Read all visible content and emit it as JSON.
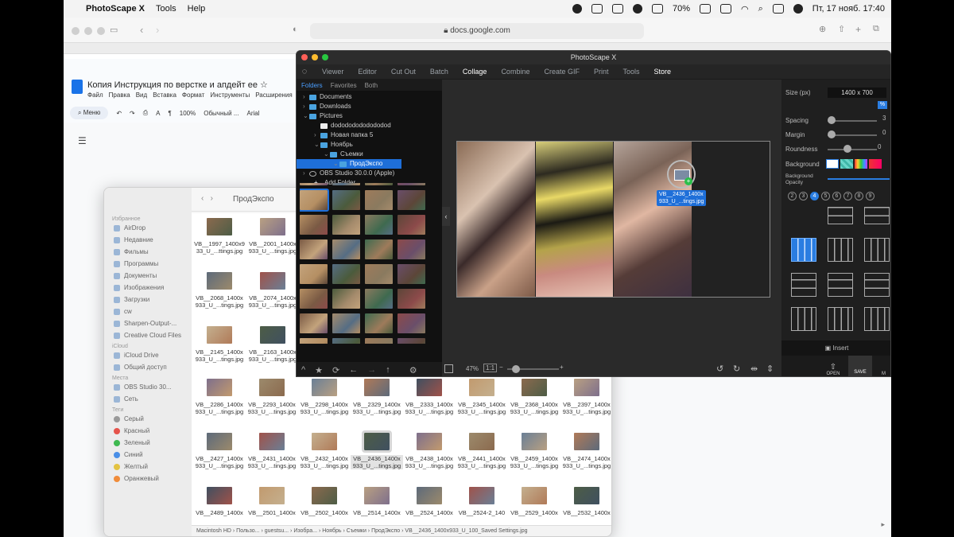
{
  "menubar": {
    "app_name": "PhotoScape X",
    "items": [
      "Tools",
      "Help"
    ],
    "battery": "70%",
    "date_time": "Пт, 17 нояб.  17:40"
  },
  "browser": {
    "url": "docs.google.com"
  },
  "doc": {
    "title": "Копия Инструкция по верстке и апдейт ее",
    "menu": [
      "Файл",
      "Правка",
      "Вид",
      "Вставка",
      "Формат",
      "Инструменты",
      "Расширения"
    ],
    "search_label": "Меню",
    "zoom": "100%",
    "style": "Обычный ...",
    "font": "Arial"
  },
  "finder": {
    "title": "ПродЭкспо",
    "sidebar": {
      "favorites_header": "Избранное",
      "favorites": [
        "AirDrop",
        "Недавние",
        "Фильмы",
        "Программы",
        "Документы",
        "Изображения",
        "Загрузки",
        "cw",
        "Sharpen-Output-...",
        "Creative Cloud Files"
      ],
      "icloud_header": "iCloud",
      "icloud": [
        "iCloud Drive",
        "Общий доступ"
      ],
      "places_header": "Места",
      "places": [
        "OBS Studio 30...",
        "Сеть"
      ],
      "tags_header": "Теги",
      "tags": [
        "Серый",
        "Красный",
        "Зеленый",
        "Синий",
        "Желтый",
        "Оранжевый"
      ]
    },
    "files": [
      {
        "l1": "VB__1997_1400x9",
        "l2": "33_U_...ttings.jpg"
      },
      {
        "l1": "VB__2001_1400x",
        "l2": "933_U_...tings.jpg"
      },
      {
        "l1": "VB__2068_1400x",
        "l2": "933_U_...tings.jpg"
      },
      {
        "l1": "VB__2074_1400x",
        "l2": "933_U_...tings.jpg"
      },
      {
        "l1": "VB__2145_1400x",
        "l2": "933_U_...tings.jpg"
      },
      {
        "l1": "VB__2163_1400x",
        "l2": "933_U_...tings.jpg"
      },
      {
        "l1": "VB__2286_1400x",
        "l2": "933_U_...tings.jpg"
      },
      {
        "l1": "VB__2293_1400x",
        "l2": "933_U_...tings.jpg"
      },
      {
        "l1": "VB__2298_1400x",
        "l2": "933_U_...tings.jpg"
      },
      {
        "l1": "VB__2329_1400x",
        "l2": "933_U_...tings.jpg"
      },
      {
        "l1": "VB__2333_1400x",
        "l2": "933_U_...tings.jpg"
      },
      {
        "l1": "VB__2345_1400x",
        "l2": "933_U_...tings.jpg"
      },
      {
        "l1": "VB__2368_1400x",
        "l2": "933_U_...tings.jpg"
      },
      {
        "l1": "VB__2397_1400x",
        "l2": "933_U_...tings.jpg"
      },
      {
        "l1": "VB__2427_1400x",
        "l2": "933_U_...tings.jpg"
      },
      {
        "l1": "VB__2431_1400x",
        "l2": "933_U_...tings.jpg"
      },
      {
        "l1": "VB__2432_1400x",
        "l2": "933_U_...tings.jpg"
      },
      {
        "l1": "VB__2436_1400x",
        "l2": "933_U_...tings.jpg"
      },
      {
        "l1": "VB__2438_1400x",
        "l2": "933_U_...tings.jpg"
      },
      {
        "l1": "VB__2441_1400x",
        "l2": "933_U_...tings.jpg"
      },
      {
        "l1": "VB__2459_1400x",
        "l2": "933_U_...tings.jpg"
      },
      {
        "l1": "VB__2474_1400x",
        "l2": "933_U_...tings.jpg"
      },
      {
        "l1": "VB__2489_1400x",
        "l2": ""
      },
      {
        "l1": "VB__2501_1400x",
        "l2": ""
      },
      {
        "l1": "VB__2502_1400x",
        "l2": ""
      },
      {
        "l1": "VB__2514_1400x",
        "l2": ""
      },
      {
        "l1": "VB__2524_1400x",
        "l2": ""
      },
      {
        "l1": "VB__2524-2_140",
        "l2": ""
      },
      {
        "l1": "VB__2529_1400x",
        "l2": ""
      },
      {
        "l1": "VB__2532_1400x",
        "l2": ""
      }
    ],
    "selected_index": 17,
    "path": "Macintosh HD  ›  Пользо...  ›  guestsu...  ›  Изобра...  ›  Ноябрь  ›  Съемки  ›  ПродЭкспо  ›  VB__2436_1400x933_U_100_Saved Settings.jpg"
  },
  "photoscape": {
    "title": "PhotoScape X",
    "nav": [
      "Viewer",
      "Editor",
      "Cut Out",
      "Batch",
      "Collage",
      "Combine",
      "Create GIF",
      "Print",
      "Tools",
      "Store"
    ],
    "active_nav": "Collage",
    "left_tabs": [
      "Folders",
      "Favorites",
      "Both"
    ],
    "tree": [
      "Documents",
      "Downloads",
      "Pictures",
      "dodododododododod",
      "Новая папка 5",
      "Ноябрь",
      "Съемки",
      "ПродЭкспо",
      "OBS Studio 30.0.0 (Apple)",
      "Add Folder"
    ],
    "zoom": "47%",
    "zoom_fit": "1:1",
    "drag_label_l1": "VB__2436_1400x",
    "drag_label_l2": "933_U_...tings.jpg",
    "right": {
      "size_label": "Size (px)",
      "size_value": "1400 x 700",
      "pct": "%",
      "spacing_label": "Spacing",
      "spacing_value": "3",
      "margin_label": "Margin",
      "margin_value": "0",
      "roundness_label": "Roundness",
      "roundness_value": "0",
      "background_label": "Background",
      "bg_opacity_label": "Background Opacity",
      "counts": [
        "2",
        "3",
        "4",
        "5",
        "6",
        "7",
        "8",
        "9"
      ],
      "selected_count": "4",
      "insert_label": "Insert",
      "open_label": "OPEN",
      "save_label": "SAVE",
      "more_label": "M"
    }
  }
}
